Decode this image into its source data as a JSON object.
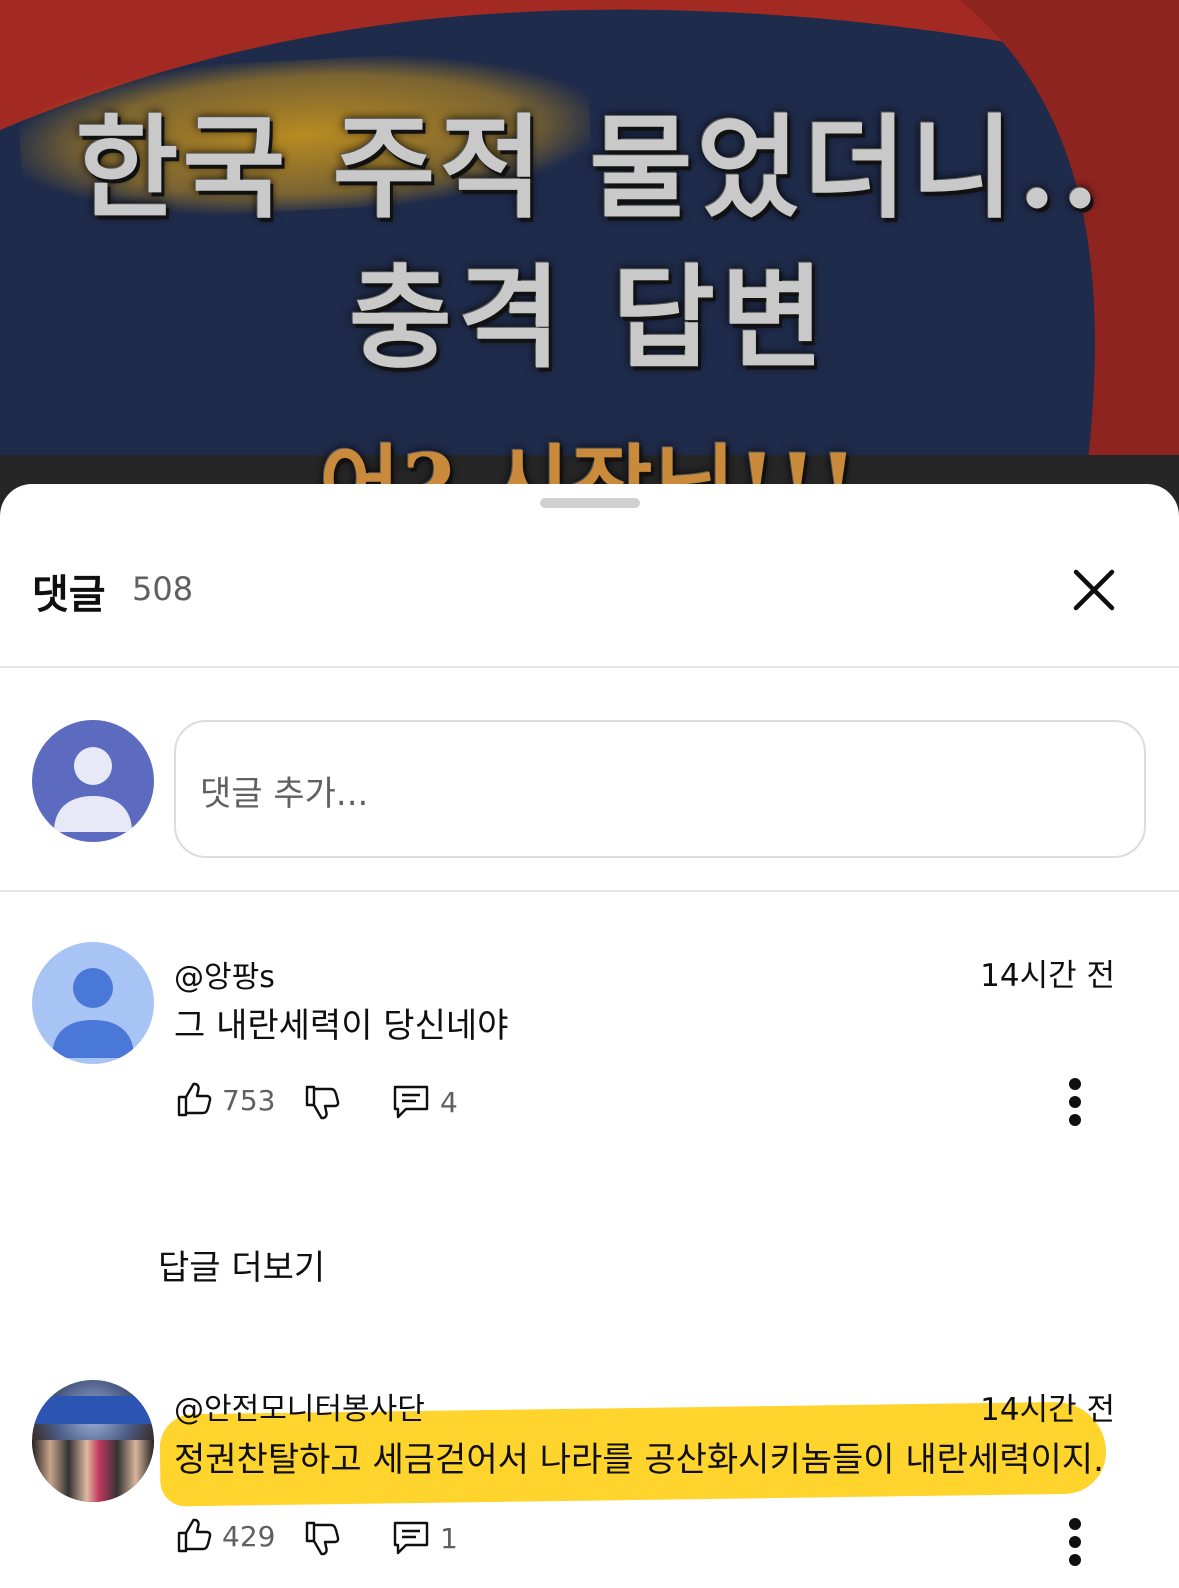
{
  "video": {
    "line1": "한국 주적 물었더니..",
    "line2": "충격 답변",
    "line3": "어? 시장님!!!"
  },
  "sheet": {
    "title": "댓글",
    "count": "508",
    "close_icon": "close-icon"
  },
  "composer": {
    "placeholder": "댓글 추가..."
  },
  "comments": [
    {
      "author": "@앙팡s",
      "time": "14시간 전",
      "text": "그 내란세력이 당신네야",
      "likes": "753",
      "replies": "4",
      "avatar": "default-avatar-light-blue"
    },
    {
      "author": "@안전모니터봉사단",
      "time": "14시간 전",
      "text": "정권찬탈하고 세금걷어서 나라를 공산화시키놈들이 내란세력이지.",
      "likes": "429",
      "replies": "1",
      "avatar": "group-photo-avatar"
    }
  ],
  "more_replies_label": "답글 더보기",
  "colors": {
    "highlight": "#fed42d",
    "my_avatar": "#5c6bc0",
    "commenter_avatar": "#a8c4f5"
  }
}
